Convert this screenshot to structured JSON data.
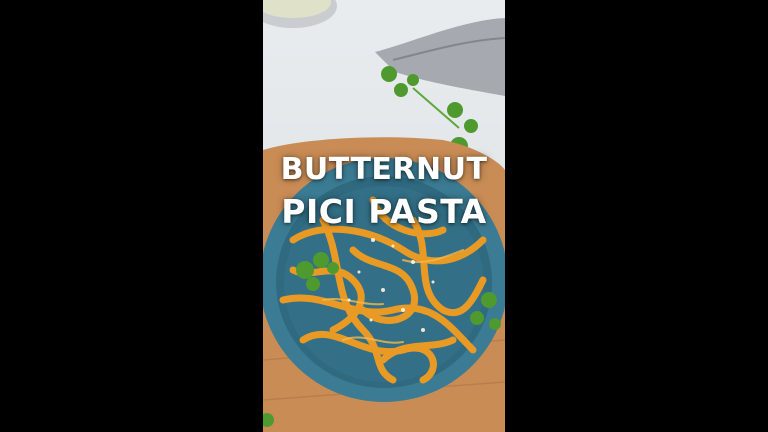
{
  "video": {
    "title_line_1": "BUTTERNUT",
    "title_line_2": "PICI PASTA"
  },
  "colors": {
    "letterbox": "#000000",
    "backdrop": "#e5e8eb",
    "plate": "#3b7b93",
    "pasta": "#e99a25",
    "parsley": "#4f9a2f",
    "board": "#c98c55",
    "title_text": "#ffffff"
  }
}
